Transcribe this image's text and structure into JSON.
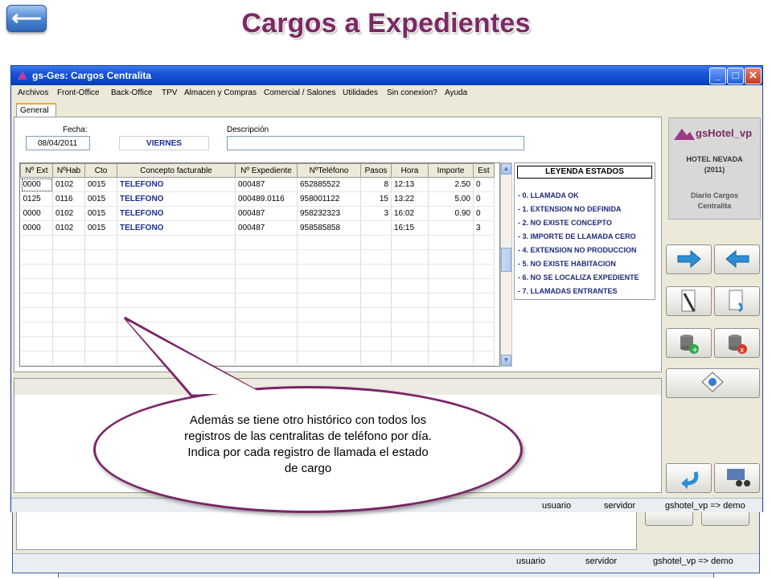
{
  "slide": {
    "title": "Cargos a Expedientes",
    "back_glyph": "⟵"
  },
  "window": {
    "title": "gs-Ges: Cargos Centralita",
    "menu": [
      "Archivos",
      "Front-Office",
      "Back-Office",
      "TPV",
      "Almacen y Compras",
      "Comercial / Salones",
      "Utilidades",
      "Sin conexion?",
      "Ayuda"
    ],
    "tab": "General",
    "fecha_label": "Fecha:",
    "fecha_value": "08/04/2011",
    "dia": "VIERNES",
    "descripcion_label": "Descripción"
  },
  "grid": {
    "columns": [
      "Nº Ext",
      "NºHab",
      "Cto",
      "Concepto facturable",
      "Nº Expediente",
      "NºTeléfono",
      "Pasos",
      "Hora",
      "Importe",
      "Est"
    ],
    "rows": [
      [
        "0000",
        "0102",
        "0015",
        "TELEFONO",
        "000487",
        "652885522",
        "8",
        "12:13",
        "2.50",
        "0"
      ],
      [
        "0125",
        "0116",
        "0015",
        "TELEFONO",
        "000489.0116",
        "958001122",
        "15",
        "13:22",
        "5.00",
        "0"
      ],
      [
        "0000",
        "0102",
        "0015",
        "TELEFONO",
        "000487",
        "958232323",
        "3",
        "16:02",
        "0.90",
        "0"
      ],
      [
        "0000",
        "0102",
        "0015",
        "TELEFONO",
        "000487",
        "958585858",
        "",
        "16:15",
        "",
        "3"
      ]
    ]
  },
  "legend": {
    "title": "LEYENDA ESTADOS",
    "items": [
      "- 0. LLAMADA OK",
      "- 1. EXTENSION NO DEFINIDA",
      "- 2. NO EXISTE CONCEPTO",
      "- 3. IMPORTE DE LLAMADA CERO",
      "- 4. EXTENSION NO PRODUCCION",
      "- 5. NO EXISTE HABITACION",
      "- 6. NO SE LOCALIZA EXPEDIENTE",
      "- 7. LLAMADAS ENTRANTES"
    ]
  },
  "logo": {
    "brand": "gsHotel_vp",
    "hotel": "HOTEL NEVADA",
    "code": "(2011)",
    "line1": "Diario Cargos",
    "line2": "Centralita"
  },
  "status": {
    "user": "usuario",
    "server": "servidor",
    "db": "gshotel_vp => demo"
  },
  "bubble": {
    "line1": "Además se tiene otro histórico con todos los",
    "line2": "registros de las centralitas de teléfono por día.",
    "line3": "Indica por cada registro de llamada el estado",
    "line4": "de cargo"
  },
  "colors": {
    "title": "#7b2a63",
    "titlebar": "#0b45c4",
    "legend_text": "#1e2a7a",
    "bubble_border": "#7b2566"
  }
}
